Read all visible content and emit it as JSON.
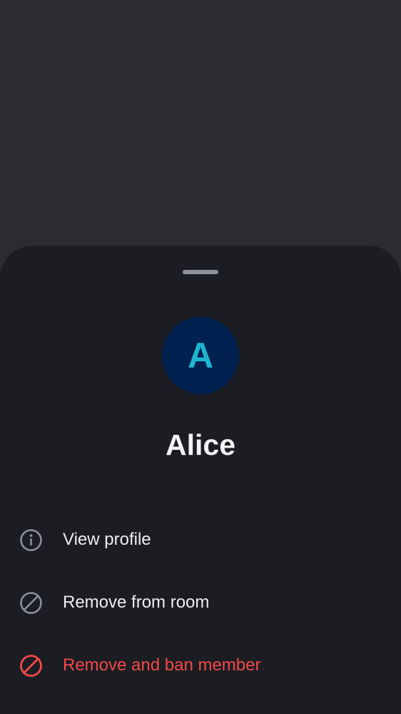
{
  "member": {
    "initial": "A",
    "name": "Alice",
    "avatar_bg": "#00214f",
    "avatar_fg": "#1eb5d1"
  },
  "actions": [
    {
      "label": "View profile",
      "icon": "info-icon",
      "style": "normal"
    },
    {
      "label": "Remove from room",
      "icon": "block-icon",
      "style": "normal"
    },
    {
      "label": "Remove and ban member",
      "icon": "ban-icon",
      "style": "danger"
    }
  ],
  "colors": {
    "scrim": "#2b2c2f",
    "sheet": "#1b1d22",
    "text": "#eceef1",
    "icon": "#8c9097",
    "danger": "#f24848"
  }
}
